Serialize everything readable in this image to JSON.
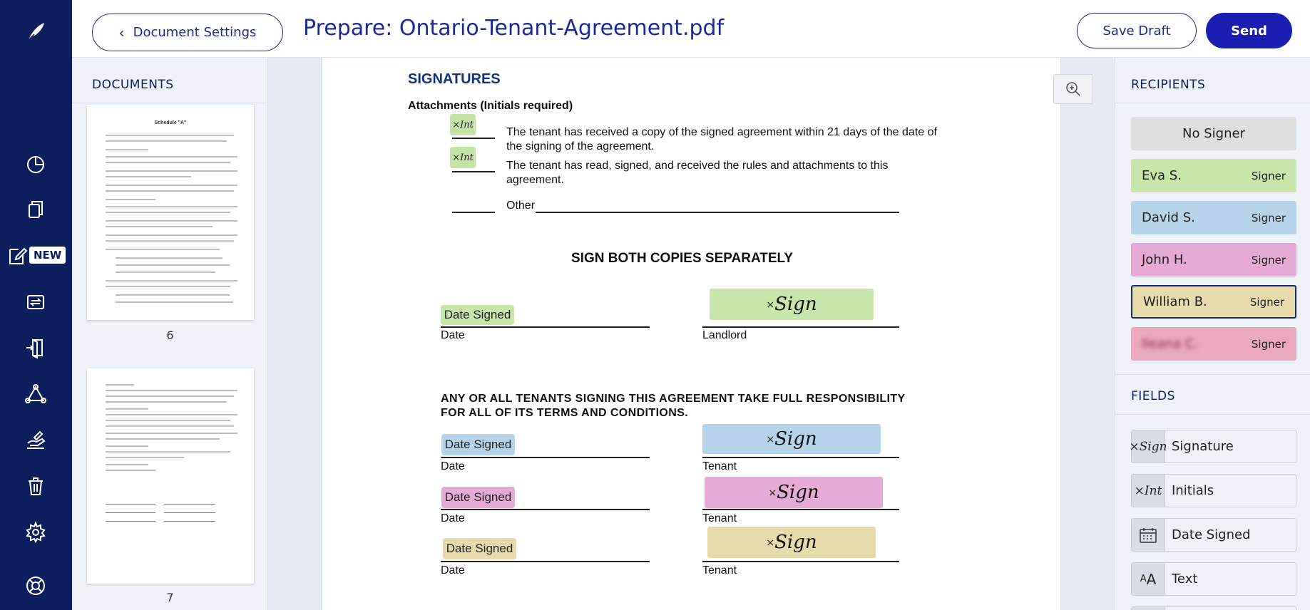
{
  "topbar": {
    "doc_settings_label": "Document Settings",
    "title": "Prepare: Ontario-Tenant-Agreement.pdf",
    "save_draft_label": "Save Draft",
    "send_label": "Send"
  },
  "nav": {
    "new_badge": "NEW",
    "icons": [
      "quill-logo-icon",
      "pie-chart-icon",
      "copy-documents-icon",
      "edit-document-icon",
      "transfer-icon",
      "exit-door-icon",
      "triangle-network-icon",
      "hand-signing-icon",
      "trash-icon",
      "gear-icon",
      "lifebuoy-icon"
    ]
  },
  "documents": {
    "heading": "DOCUMENTS",
    "thumb_title": "Schedule \"A\"",
    "pages": [
      "6",
      "7"
    ]
  },
  "document": {
    "signatures_heading": "SIGNATURES",
    "attachments_heading": "Attachments (Initials required)",
    "initials_label": "×Int",
    "item1_line1": "The tenant has received a copy of the signed agreement within 21 days of the date of",
    "item1_line2": "the signing of the agreement.",
    "item2_line1": "The tenant has read, signed, and received the rules and attachments to this",
    "item2_line2": "agreement.",
    "other_label": "Other",
    "sign_both": "SIGN BOTH COPIES SEPARATELY",
    "date_signed_label": "Date Signed",
    "sign_label": "Sign",
    "date_label": "Date",
    "landlord_label": "Landlord",
    "tenants_line1": "ANY OR ALL TENANTS SIGNING THIS AGREEMENT TAKE FULL RESPONSIBILITY",
    "tenants_line2": "FOR ALL OF ITS TERMS AND CONDITIONS.",
    "tenant_label": "Tenant"
  },
  "recipients": {
    "heading": "RECIPIENTS",
    "no_signer": "No Signer",
    "items": [
      {
        "name": "Eva S.",
        "role": "Signer",
        "color": "#c8e6a9"
      },
      {
        "name": "David S.",
        "role": "Signer",
        "color": "#b5d4ea"
      },
      {
        "name": "John H.",
        "role": "Signer",
        "color": "#e6aad6"
      },
      {
        "name": "William B.",
        "role": "Signer",
        "color": "#e7dbab"
      },
      {
        "name": "Ileana C.",
        "role": "Signer",
        "color": "#eaa9bd"
      }
    ]
  },
  "fields": {
    "heading": "FIELDS",
    "items": [
      {
        "label": "Signature",
        "icon": "signature-icon"
      },
      {
        "label": "Initials",
        "icon": "initials-icon"
      },
      {
        "label": "Date Signed",
        "icon": "calendar-icon"
      },
      {
        "label": "Text",
        "icon": "text-icon"
      }
    ]
  },
  "colors": {
    "nav_bg": "#0d1e5c",
    "accent": "#1a1fb0",
    "landlord": "#c8e6a9",
    "tenant1": "#b5d4ea",
    "tenant2": "#e6aad6",
    "tenant3": "#e7dbab"
  }
}
